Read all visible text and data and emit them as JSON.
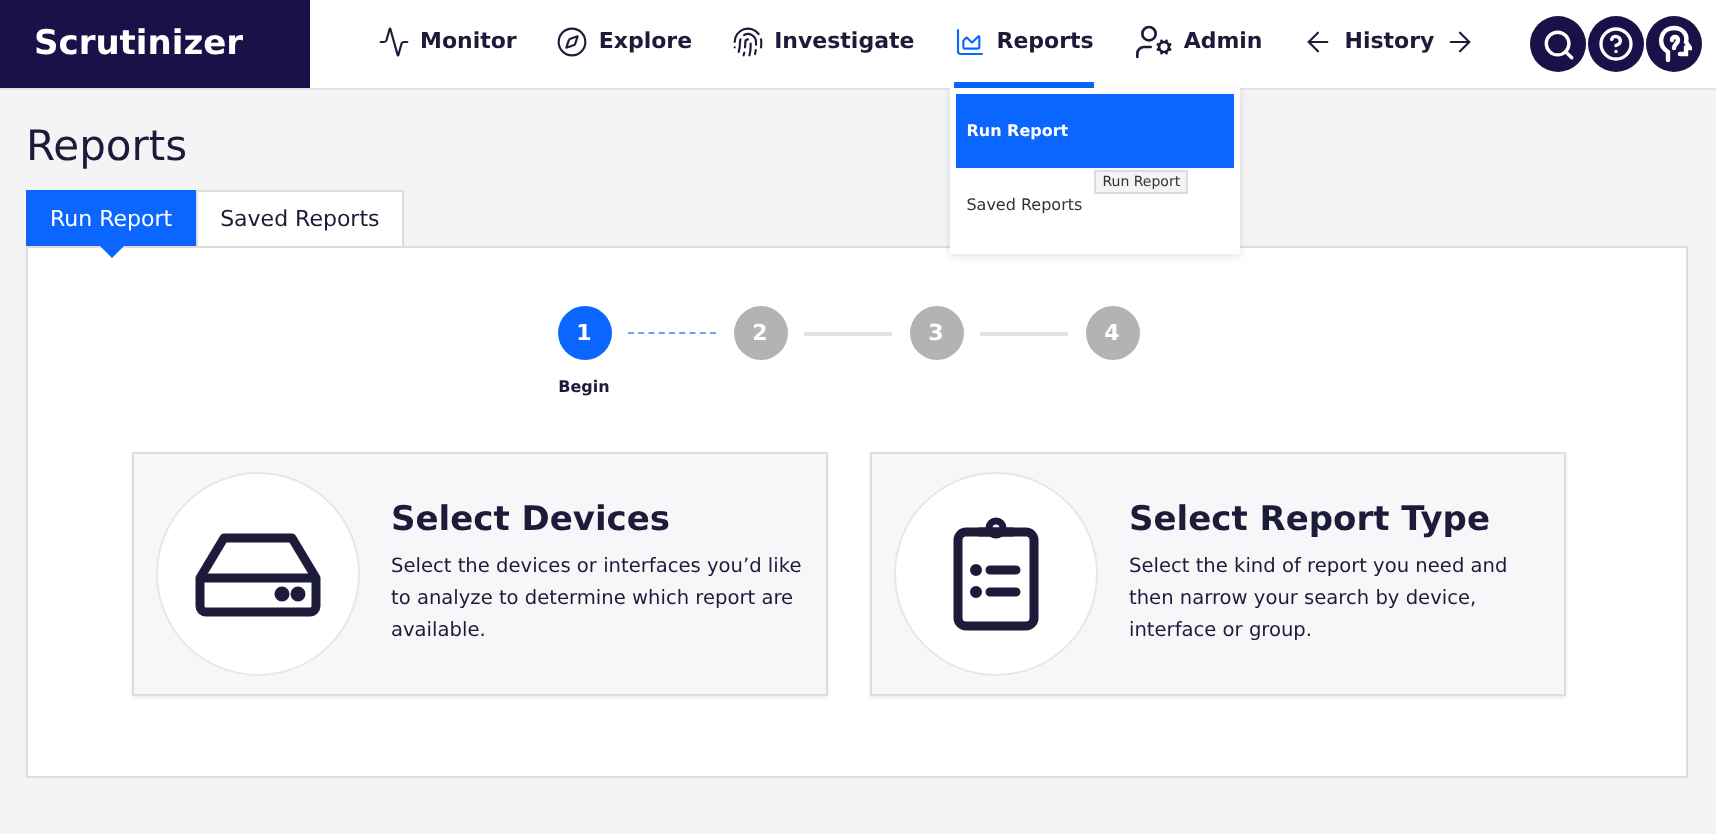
{
  "brand": "Scrutinizer",
  "nav": [
    {
      "kind": "monitor",
      "label": "Monitor",
      "selected": false
    },
    {
      "kind": "explore",
      "label": "Explore",
      "selected": false
    },
    {
      "kind": "investigate",
      "label": "Investigate",
      "selected": false
    },
    {
      "kind": "reports",
      "label": "Reports",
      "selected": true,
      "menu": [
        {
          "label": "Run Report",
          "selected": true,
          "tooltip": "Run Report"
        },
        {
          "label": "Saved Reports",
          "selected": false
        }
      ]
    },
    {
      "kind": "admin",
      "label": "Admin",
      "selected": false
    },
    {
      "kind": "history",
      "label": "History",
      "selected": false
    }
  ],
  "header_buttons": [
    {
      "kind": "search"
    },
    {
      "kind": "help"
    },
    {
      "kind": "profile"
    }
  ],
  "page_title": "Reports",
  "tabs": [
    {
      "label": "Run Report",
      "selected": true
    },
    {
      "label": "Saved Reports",
      "selected": false
    }
  ],
  "steps": [
    {
      "number": "1",
      "label": "Begin",
      "selected": true
    },
    {
      "number": "2",
      "selected": false
    },
    {
      "number": "3",
      "selected": false
    },
    {
      "number": "4",
      "selected": false
    }
  ],
  "cards": [
    {
      "kind": "devices",
      "title": "Select Devices",
      "description": "Select the devices or interfaces you’d like to analyze to determine which report are available."
    },
    {
      "kind": "report-type",
      "title": "Select Report Type",
      "description": "Select the kind of report you need and then narrow your search by device, interface or group."
    }
  ]
}
